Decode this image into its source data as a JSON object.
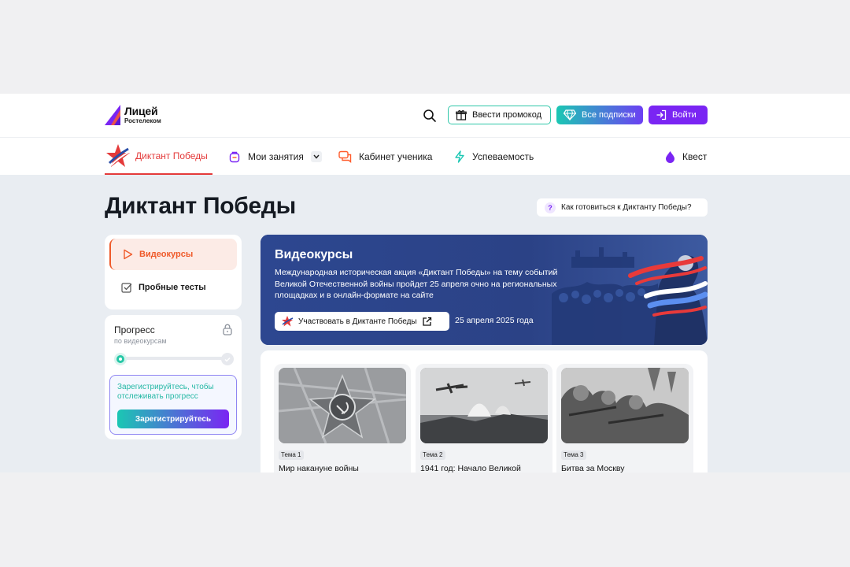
{
  "header": {
    "logo_title": "Лицей",
    "logo_sub": "Ростелеком",
    "promo_label": "Ввести промокод",
    "subs_label": "Все подписки",
    "login_label": "Войти"
  },
  "nav": {
    "dictant": "Диктант Победы",
    "lessons": "Мои занятия",
    "cabinet": "Кабинет ученика",
    "progress": "Успеваемость",
    "quest": "Квест"
  },
  "page": {
    "title": "Диктант Победы",
    "help_link": "Как готовиться к Диктанту Победы?"
  },
  "sidebar": {
    "items": [
      {
        "label": "Видеокурсы"
      },
      {
        "label": "Пробные тесты"
      }
    ]
  },
  "progress": {
    "title": "Прогресс",
    "subtitle": "по видеокурсам",
    "value": 0,
    "register_text": "Зарегистрируйтесь, чтобы отслеживать прогресс",
    "register_button": "Зарегистрируйтесь"
  },
  "banner": {
    "title": "Видеокурсы",
    "text": "Международная историческая акция «Диктант Победы» на тему событий Великой Отечественной войны пройдет 25 апреля очно на региональных площадках и в онлайн-формате на сайте",
    "button": "Участвовать в Диктанте Победы",
    "date": "25 апреля 2025 года"
  },
  "cards": [
    {
      "tag": "Тема 1",
      "title": "Мир накануне войны"
    },
    {
      "tag": "Тема 2",
      "title": "1941 год: Начало Великой"
    },
    {
      "tag": "Тема 3",
      "title": "Битва за Москву"
    }
  ],
  "colors": {
    "accent_purple": "#7a25f3",
    "accent_teal": "#1bc7b3",
    "active_red": "#e43a3a",
    "active_orange": "#ef5a2a"
  }
}
